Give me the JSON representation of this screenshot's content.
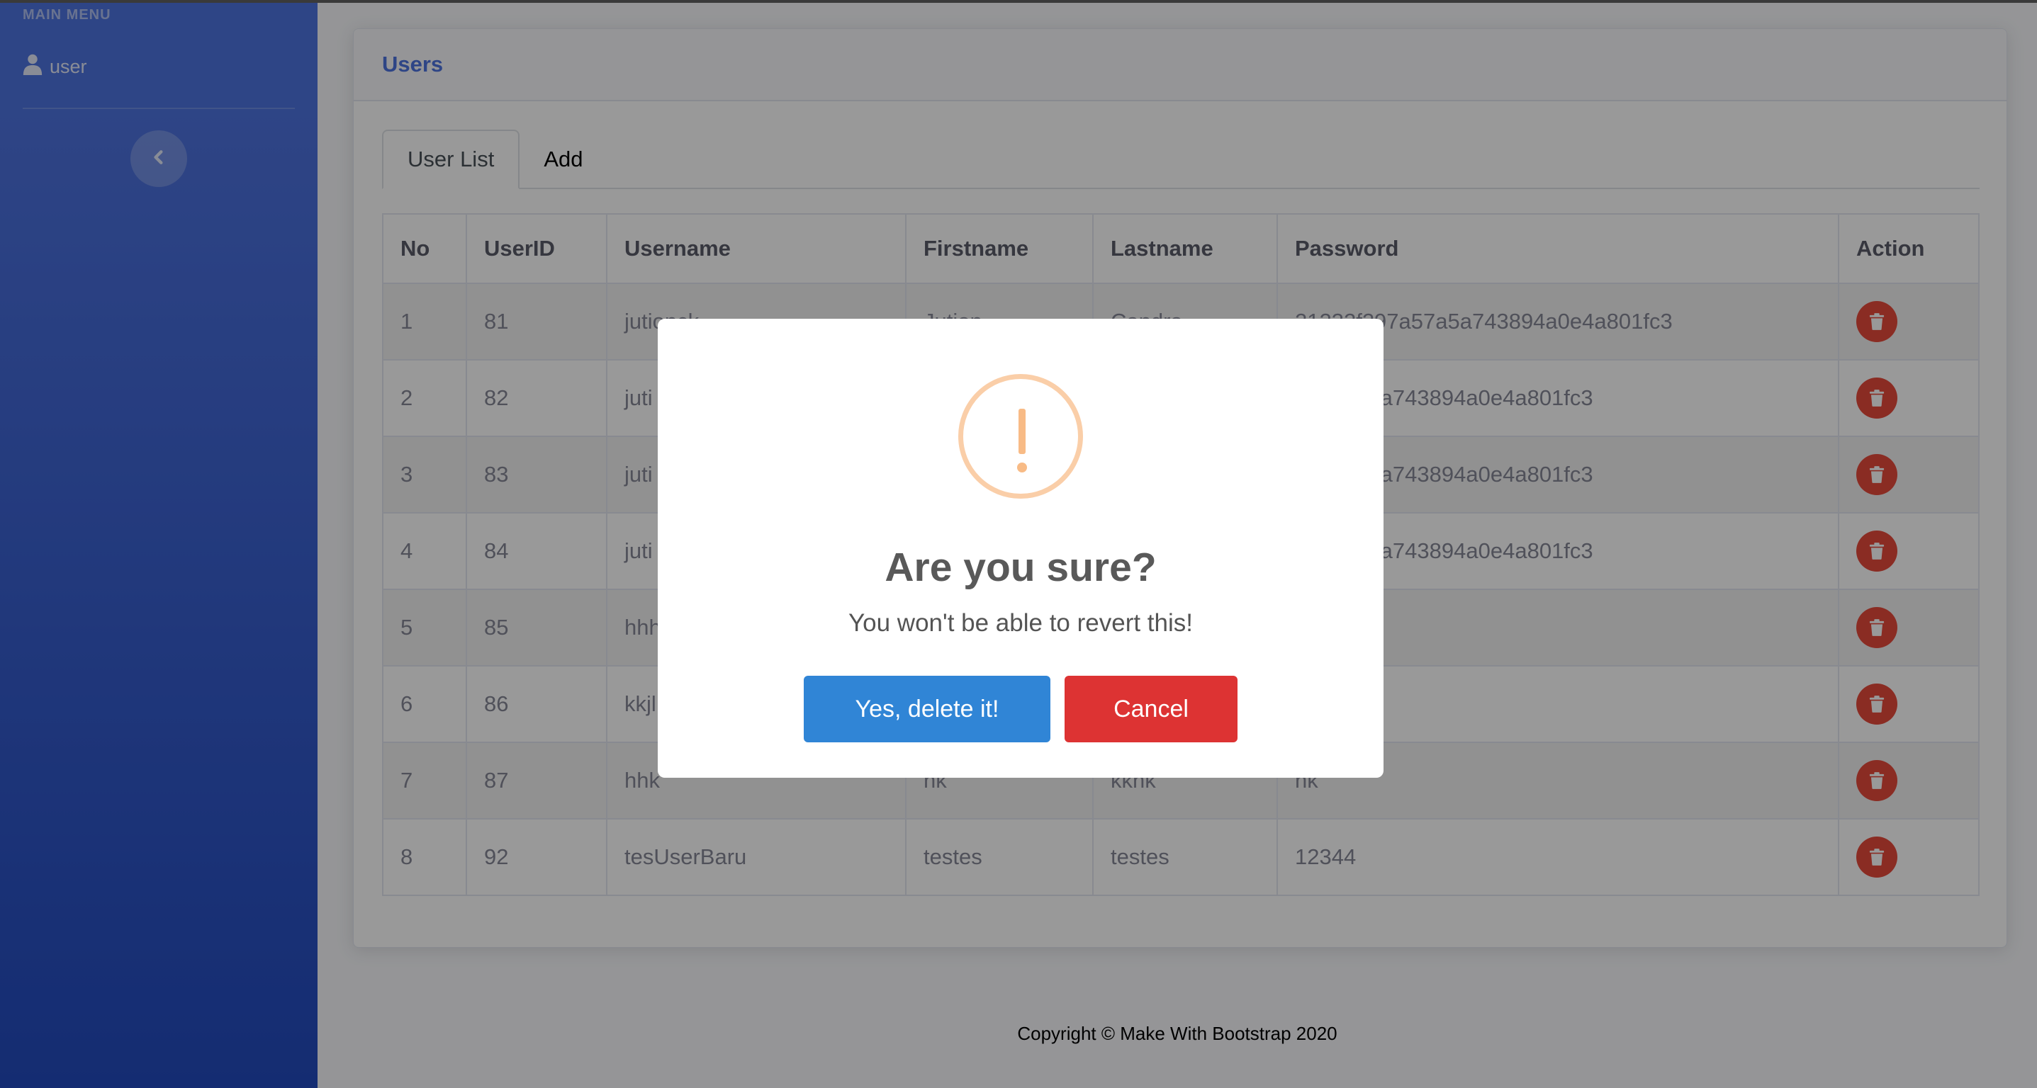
{
  "sidebar": {
    "heading": "MAIN MENU",
    "item_user": "user"
  },
  "card": {
    "title": "Users"
  },
  "tabs": [
    {
      "label": "User List",
      "active": true
    },
    {
      "label": "Add",
      "active": false
    }
  ],
  "table": {
    "headers": [
      "No",
      "UserID",
      "Username",
      "Firstname",
      "Lastname",
      "Password",
      "Action"
    ],
    "rows": [
      [
        "1",
        "81",
        "jutionck",
        "Jution",
        "Candra",
        "21232f297a57a5a743894a0e4a801fc3"
      ],
      [
        "2",
        "82",
        "juti",
        "",
        "",
        "97a57a5a743894a0e4a801fc3"
      ],
      [
        "3",
        "83",
        "juti",
        "",
        "",
        "97a57a5a743894a0e4a801fc3"
      ],
      [
        "4",
        "84",
        "juti",
        "",
        "",
        "97a57a5a743894a0e4a801fc3"
      ],
      [
        "5",
        "85",
        "hhh",
        "",
        "",
        ""
      ],
      [
        "6",
        "86",
        "kkjl",
        "",
        "",
        ""
      ],
      [
        "7",
        "87",
        "hhk",
        "hk",
        "kkhk",
        "hk"
      ],
      [
        "8",
        "92",
        "tesUserBaru",
        "testes",
        "testes",
        "12344"
      ]
    ]
  },
  "footer": {
    "text": "Copyright © Make With Bootstrap 2020"
  },
  "modal": {
    "title": "Are you sure?",
    "text": "You won't be able to revert this!",
    "confirm_label": "Yes, delete it!",
    "cancel_label": "Cancel"
  },
  "colors": {
    "primary": "#4e73df",
    "danger": "#e74a3b",
    "confirm": "#3085d6",
    "cancel": "#dd3333",
    "warning": "#f8bb86"
  }
}
